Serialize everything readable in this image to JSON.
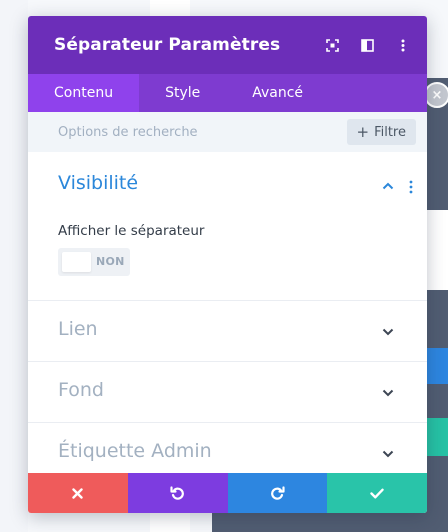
{
  "modal": {
    "title": "Séparateur Paramètres"
  },
  "tabs": [
    {
      "label": "Contenu",
      "active": true
    },
    {
      "label": "Style",
      "active": false
    },
    {
      "label": "Avancé",
      "active": false
    }
  ],
  "search": {
    "placeholder": "Options de recherche",
    "filter_label": "Filtre"
  },
  "sections": {
    "visibility": {
      "title": "Visibilité",
      "field_label": "Afficher le séparateur",
      "toggle_value": "NON"
    },
    "link": {
      "title": "Lien"
    },
    "background": {
      "title": "Fond"
    },
    "admin_label": {
      "title": "Étiquette Admin"
    }
  },
  "colors": {
    "header": "#6c2eb9",
    "tabs": "#7e3bd0",
    "tab_active": "#8f42ec",
    "accent_blue": "#2b87da",
    "cancel": "#ef5b5b",
    "undo": "#7d3ce0",
    "redo": "#2d86e0",
    "save": "#29c4a9"
  },
  "icons": {
    "expand": "expand-icon",
    "columns": "columns-icon",
    "menu": "kebab-menu-icon",
    "cancel": "close-icon",
    "undo": "undo-icon",
    "redo": "redo-icon",
    "save": "checkmark-icon"
  }
}
